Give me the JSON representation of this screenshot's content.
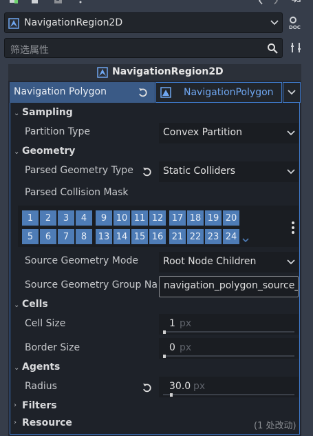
{
  "toolbar": {
    "icons": [
      "new-script-icon",
      "copy-icon",
      "save-icon",
      "more-icon",
      "back-icon",
      "forward-icon",
      "history-icon"
    ]
  },
  "node_selector": {
    "value": "NavigationRegion2D",
    "doc_icon": "doc-icon"
  },
  "filter": {
    "placeholder": "筛选属性"
  },
  "header": {
    "title": "NavigationRegion2D"
  },
  "resource": {
    "property_label": "Navigation Polygon",
    "value": "NavigationPolygon"
  },
  "sections": {
    "sampling": "Sampling",
    "geometry": "Geometry",
    "cells": "Cells",
    "agents": "Agents",
    "filters": "Filters",
    "resource": "Resource"
  },
  "properties": {
    "partition_type": {
      "label": "Partition Type",
      "value": "Convex Partition"
    },
    "parsed_geometry_type": {
      "label": "Parsed Geometry Type",
      "value": "Static Colliders"
    },
    "parsed_collision_mask": {
      "label": "Parsed Collision Mask"
    },
    "source_geometry_mode": {
      "label": "Source Geometry Mode",
      "value": "Root Node Children"
    },
    "source_geometry_group": {
      "label": "Source Geometry Group Na",
      "value": "navigation_polygon_source_"
    },
    "cell_size": {
      "label": "Cell Size",
      "value": "1",
      "unit": "px",
      "slider_level": 0.0
    },
    "border_size": {
      "label": "Border Size",
      "value": "0",
      "unit": "px",
      "slider_level": 0.0
    },
    "radius": {
      "label": "Radius",
      "value": "30.0",
      "unit": "px",
      "slider_level": 0.05
    }
  },
  "collision_mask": {
    "row1": [
      "1",
      "2",
      "3",
      "4",
      "9",
      "10",
      "11",
      "12",
      "17",
      "18",
      "19",
      "20"
    ],
    "row2": [
      "5",
      "6",
      "7",
      "8",
      "13",
      "14",
      "15",
      "16",
      "21",
      "22",
      "23",
      "24"
    ]
  },
  "resource_changes": "(1 处改动)",
  "colors": {
    "accent": "#3f7acb",
    "bit_on": "#4e7cb6",
    "resource_left": "#3a5a86"
  }
}
